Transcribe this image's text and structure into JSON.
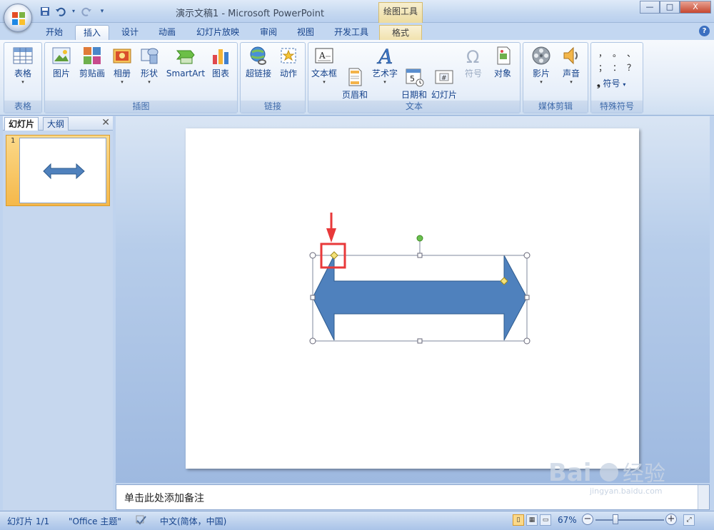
{
  "window": {
    "title": "演示文稿1 - Microsoft PowerPoint",
    "context_tab": "绘图工具",
    "buttons": {
      "minimize": "—",
      "maximize": "□",
      "close": "X"
    }
  },
  "ribbon_tabs": [
    "开始",
    "插入",
    "设计",
    "动画",
    "幻灯片放映",
    "审阅",
    "视图",
    "开发工具",
    "格式"
  ],
  "active_tab": "插入",
  "help_glyph": "?",
  "groups": {
    "table": {
      "label": "表格",
      "buttons": [
        "表格"
      ]
    },
    "illustrations": {
      "label": "插图",
      "buttons": [
        "图片",
        "剪贴画",
        "相册",
        "形状",
        "SmartArt",
        "图表"
      ]
    },
    "links": {
      "label": "链接",
      "buttons": [
        "超链接",
        "动作"
      ]
    },
    "text": {
      "label": "文本",
      "buttons": [
        "文本框",
        "页眉和\n页脚",
        "艺术字",
        "日期和\n时间",
        "幻灯片\n编号",
        "符号",
        "对象"
      ]
    },
    "media": {
      "label": "媒体剪辑",
      "buttons": [
        "影片",
        "声音"
      ]
    },
    "special": {
      "label": "特殊符号",
      "symbols": [
        "，",
        "。",
        "、",
        "；",
        "：",
        "？"
      ],
      "symbol_button": "符号"
    }
  },
  "dropdown_arrow": "▾",
  "panel": {
    "tabs": [
      "幻灯片",
      "大纲"
    ],
    "close": "✕",
    "slide_number": "1"
  },
  "notes_placeholder": "单击此处添加备注",
  "status": {
    "slide": "幻灯片 1/1",
    "theme": "\"Office 主题\"",
    "language": "中文(简体，中国)",
    "zoom": "67%"
  },
  "watermark": {
    "text": "Bai 经验",
    "url": "jingyan.baidu.com"
  },
  "colors": {
    "shape_fill": "#4f81bd",
    "shape_stroke": "#2e5b8e",
    "annotation": "#e8393a"
  }
}
